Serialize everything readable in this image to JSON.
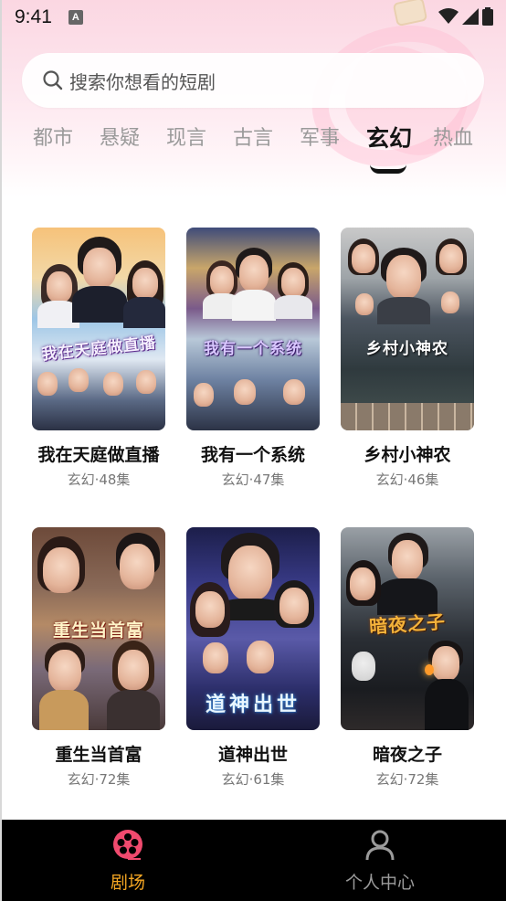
{
  "status_bar": {
    "time": "9:41",
    "notification_icon_letter": "A"
  },
  "search": {
    "placeholder": "搜索你想看的短剧"
  },
  "tabs": [
    {
      "label": "都市",
      "active": false
    },
    {
      "label": "悬疑",
      "active": false
    },
    {
      "label": "现言",
      "active": false
    },
    {
      "label": "古言",
      "active": false
    },
    {
      "label": "军事",
      "active": false
    },
    {
      "label": "玄幻",
      "active": true
    },
    {
      "label": "热血",
      "active": false
    }
  ],
  "dramas": [
    {
      "title": "我在天庭做直播",
      "meta": "玄幻·48集",
      "poster_text": "我在天庭做直播"
    },
    {
      "title": "我有一个系统",
      "meta": "玄幻·47集",
      "poster_text": "我有一个系统"
    },
    {
      "title": "乡村小神农",
      "meta": "玄幻·46集",
      "poster_text": "乡村小神农"
    },
    {
      "title": "重生当首富",
      "meta": "玄幻·72集",
      "poster_text": "重生当首富"
    },
    {
      "title": "道神出世",
      "meta": "玄幻·61集",
      "poster_text": "道神出世"
    },
    {
      "title": "暗夜之子",
      "meta": "玄幻·72集",
      "poster_text": "暗夜之子"
    }
  ],
  "bottom_nav": [
    {
      "label": "剧场",
      "icon": "film-reel-icon",
      "active": true
    },
    {
      "label": "个人中心",
      "icon": "user-icon",
      "active": false
    }
  ],
  "colors": {
    "accent": "#f04a6e",
    "active_nav_label": "#f5a623",
    "inactive_nav": "#9b9b9b",
    "header_gradient": "#fbd7e2"
  }
}
